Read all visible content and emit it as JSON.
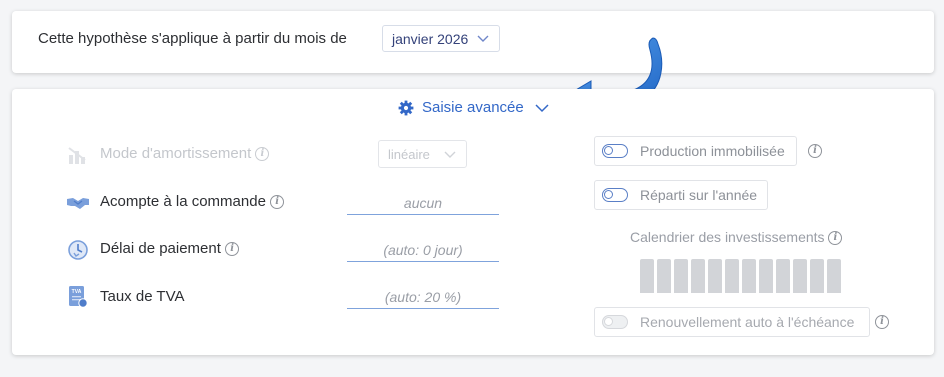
{
  "hypothesis": {
    "text": "Cette hypothèse s'applique à partir du mois de",
    "month_value": "janvier 2026"
  },
  "advanced": {
    "label": "Saisie avancée"
  },
  "left_rows": [
    {
      "label": "Mode d'amortissement",
      "value": "linéaire",
      "enabled": false
    },
    {
      "label": "Acompte à la commande",
      "value": "aucun"
    },
    {
      "label": "Délai de paiement",
      "value": "(auto: 0 jour)"
    },
    {
      "label": "Taux de TVA",
      "value": "(auto: 20 %)"
    }
  ],
  "right": {
    "production_label": "Production immobilisée",
    "reparti_label": "Réparti sur l'année",
    "calendar_title": "Calendrier des investissements",
    "calendar_months": 12,
    "renewal_label": "Renouvellement auto à l'échéance"
  },
  "tva_icon_text": "TVA",
  "colors": {
    "accent": "#3368c8",
    "arrow": "#2f7fd9",
    "field_underline": "#7fa3dc"
  }
}
